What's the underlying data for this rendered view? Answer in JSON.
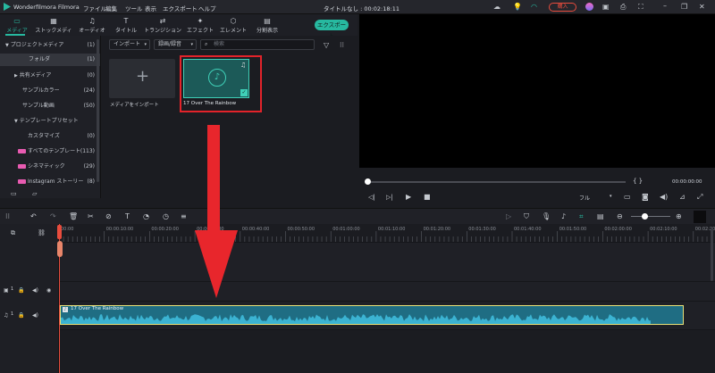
{
  "app": {
    "name": "Wonderfilmora Filmora",
    "project_title": "タイトルなし : 00:02:18:11"
  },
  "menu": [
    "ファイル",
    "編集",
    "ツール",
    "表示",
    "エクスポート",
    "ヘルプ"
  ],
  "titlebar": {
    "buy_label": "購入"
  },
  "main_tabs": [
    {
      "label": "メディア",
      "icon": "folder-icon",
      "active": true
    },
    {
      "label": "ストックメディア",
      "icon": "stock-media-icon"
    },
    {
      "label": "オーディオ",
      "icon": "audio-icon"
    },
    {
      "label": "タイトル",
      "icon": "title-icon"
    },
    {
      "label": "トランジション",
      "icon": "transition-icon"
    },
    {
      "label": "エフェクト",
      "icon": "effect-icon"
    },
    {
      "label": "エレメント",
      "icon": "element-icon"
    },
    {
      "label": "分割表示",
      "icon": "split-screen-icon"
    }
  ],
  "export_label": "エクスポート",
  "sidebar": {
    "items": [
      {
        "label": "プロジェクトメディア",
        "count": "(1)",
        "caret": "▼"
      },
      {
        "label": "フォルダ",
        "count": "(1)",
        "selected": true
      },
      {
        "label": "共有メディア",
        "count": "(0)",
        "caret": "▶"
      },
      {
        "label": "サンプルカラー",
        "count": "(24)"
      },
      {
        "label": "サンプル動画",
        "count": "(50)"
      },
      {
        "label": "テンプレートプリセット",
        "count": "",
        "caret": "▼"
      },
      {
        "label": "カスタマイズ",
        "count": "(0)"
      },
      {
        "label": "すべてのテンプレート",
        "count": "(113)",
        "badge": true
      },
      {
        "label": "シネマティック",
        "count": "(29)",
        "badge": true
      },
      {
        "label": "Instagram ストーリー",
        "count": "(8)",
        "badge": true
      }
    ]
  },
  "media_toolbar": {
    "import_label": "インポート",
    "record_label": "録画/録音",
    "search_placeholder": "検索"
  },
  "media_items": {
    "import_label": "メディアをインポート",
    "clip_name": "17 Over The Rainbow"
  },
  "preview": {
    "timecode": "00:00:00:00",
    "brackets": "{    }",
    "quality": "フル"
  },
  "ruler_labels": [
    "00:00",
    "00:00:10:00",
    "00:00:20:00",
    "00:00:30:00",
    "00:00:40:00",
    "00:00:50:00",
    "00:01:00:00",
    "00:01:10:00",
    "00:01:20:00",
    "00:01:30:00",
    "00:01:40:00",
    "00:01:50:00",
    "00:02:00:00",
    "00:02:10:00",
    "00:02:20:00"
  ],
  "timeline": {
    "audio_clip_label": "17 Over The Rainbow",
    "video_track_num": "1",
    "audio_track_num": "1"
  },
  "colors": {
    "accent": "#27b9a0",
    "annotation": "#e3232a",
    "clip_fill": "#1f6d83",
    "clip_border": "#e8e27a"
  }
}
